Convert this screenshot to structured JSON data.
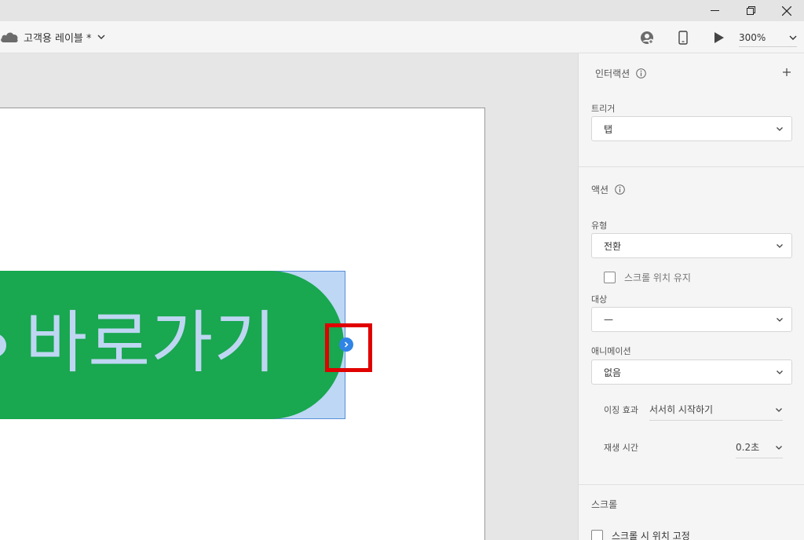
{
  "window": {
    "controls": [
      "minimize-icon",
      "restore-icon",
      "close-icon"
    ]
  },
  "toolbar": {
    "doc_title": "고객용 레이블 *",
    "zoom": "300%",
    "icons": [
      "cloud-icon",
      "user-share-icon",
      "phone-preview-icon",
      "play-icon"
    ]
  },
  "canvas": {
    "button_text": "바로가기",
    "colors": {
      "button": "#19a74f",
      "text": "#bfd6f3",
      "selection": "#bdd7f5",
      "handle": "#2f84e6",
      "highlight": "#e00000"
    }
  },
  "panel": {
    "interaction_title": "인터랙션",
    "trigger_label": "트리거",
    "trigger_value": "탭",
    "action_title": "액션",
    "type_label": "유형",
    "type_value": "전환",
    "keep_scroll_label": "스크롤 위치 유지",
    "target_label": "대상",
    "target_value": "—",
    "animation_label": "애니메이션",
    "animation_value": "없음",
    "easing_label": "이징 효과",
    "easing_value": "서서히 시작하기",
    "duration_label": "재생 시간",
    "duration_value": "0.2초",
    "scroll_title": "스크롤",
    "fix_position_label": "스크롤 시 위치 고정"
  }
}
